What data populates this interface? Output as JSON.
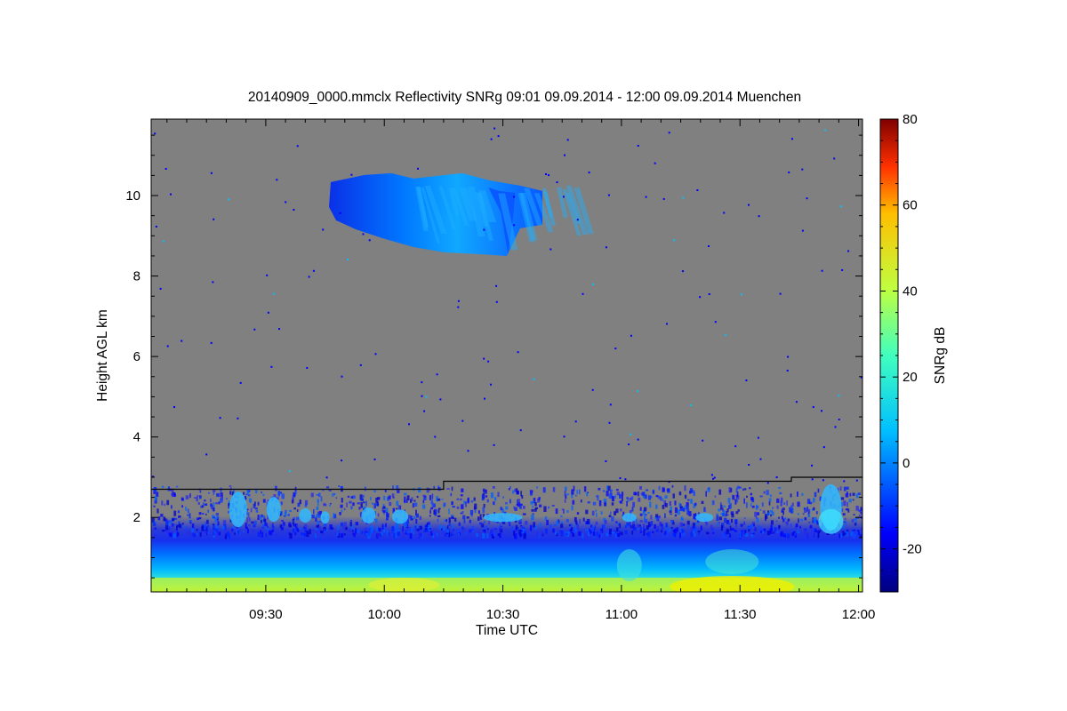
{
  "chart_data": {
    "type": "heatmap",
    "title": "20140909_0000.mmclx Reflectivity SNRg   09:01 09.09.2014 - 12:00 09.09.2014 Muenchen",
    "xlabel": "Time UTC",
    "ylabel": "Height AGL km",
    "x_range_minutes_utc": [
      541,
      721
    ],
    "y_range_km": [
      0.15,
      11.9
    ],
    "x_ticks": [
      {
        "minutes": 570,
        "label": "09:30"
      },
      {
        "minutes": 600,
        "label": "10:00"
      },
      {
        "minutes": 630,
        "label": "10:30"
      },
      {
        "minutes": 660,
        "label": "11:00"
      },
      {
        "minutes": 690,
        "label": "11:30"
      },
      {
        "minutes": 720,
        "label": "12:00"
      }
    ],
    "y_ticks": [
      2,
      4,
      6,
      8,
      10
    ],
    "colorbar": {
      "label": "SNRg dB",
      "range": [
        -30,
        80
      ],
      "ticks": [
        -20,
        0,
        20,
        40,
        60,
        80
      ],
      "colormap": "jet",
      "no_signal_color": "#808080"
    },
    "boundary_line_km": [
      {
        "minutes": 541,
        "height": 2.7
      },
      {
        "minutes": 615,
        "height": 2.7
      },
      {
        "minutes": 615,
        "height": 2.9
      },
      {
        "minutes": 703,
        "height": 2.9
      },
      {
        "minutes": 703,
        "height": 3.0
      },
      {
        "minutes": 721,
        "height": 3.0
      }
    ],
    "features": {
      "cirrus_cloud": {
        "minutes": [
          586,
          634
        ],
        "height_km": [
          8.5,
          10.6
        ],
        "snr_db_range": [
          -20,
          5
        ]
      },
      "boundary_layer": {
        "minutes": [
          541,
          721
        ],
        "height_km": [
          0.15,
          2.7
        ],
        "snr_db_range": [
          -25,
          40
        ]
      }
    }
  }
}
